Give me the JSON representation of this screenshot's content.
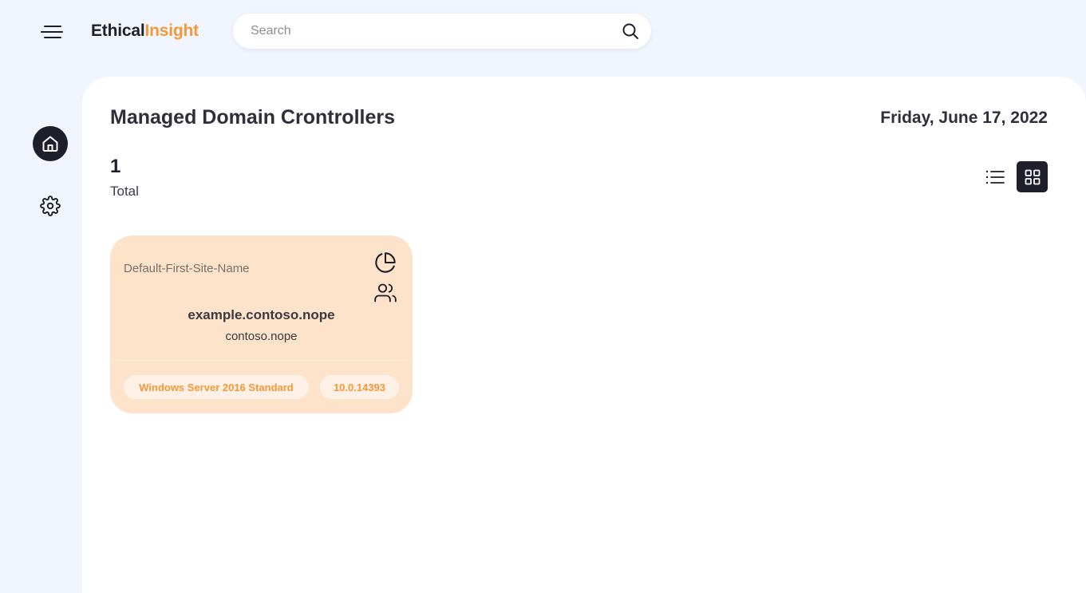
{
  "header": {
    "logo_part1": "Ethical",
    "logo_part2": "Insight",
    "search_placeholder": "Search"
  },
  "sidebar": {
    "items": [
      {
        "name": "home",
        "icon": "home-icon",
        "active": true
      },
      {
        "name": "settings",
        "icon": "gear-icon",
        "active": false
      }
    ]
  },
  "main": {
    "title": "Managed Domain Crontrollers",
    "date": "Friday, June 17, 2022",
    "total_count": "1",
    "total_label": "Total",
    "view_mode": "grid"
  },
  "cards": [
    {
      "site": "Default-First-Site-Name",
      "hostname": "example.contoso.nope",
      "domain": "contoso.nope",
      "os": "Windows Server 2016 Standard",
      "version": "10.0.14393"
    }
  ],
  "colors": {
    "background": "#f1f5fd",
    "dark": "#1f1e2b",
    "accent": "#f6983a",
    "card": "#fde3c9",
    "badge": "#fdf1e6"
  }
}
